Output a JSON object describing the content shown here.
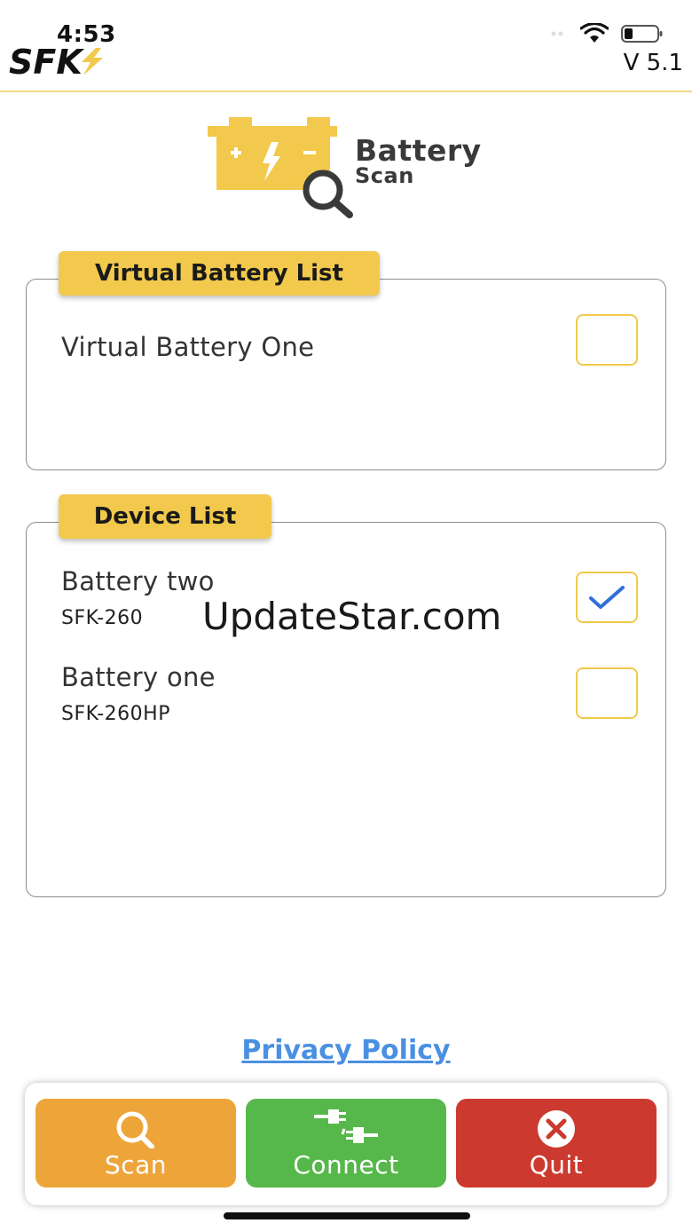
{
  "status_bar": {
    "time": "4:53",
    "brand": "SFK",
    "version": "V 5.1"
  },
  "hero": {
    "title": "Battery",
    "subtitle": "Scan"
  },
  "virtual_list": {
    "title": "Virtual Battery List",
    "items": [
      {
        "name": "Virtual Battery One",
        "checked": false
      }
    ]
  },
  "device_list": {
    "title": "Device List",
    "items": [
      {
        "name": "Battery two",
        "model": "SFK-260",
        "checked": true
      },
      {
        "name": "Battery one",
        "model": "SFK-260HP",
        "checked": false
      }
    ]
  },
  "watermark": "UpdateStar.com",
  "privacy_link": "Privacy Policy",
  "toolbar": {
    "scan_label": "Scan",
    "connect_label": "Connect",
    "quit_label": "Quit"
  },
  "colors": {
    "accent_yellow": "#f2c94c",
    "scan_orange": "#eda53a",
    "connect_green": "#56b84a",
    "quit_red": "#cc3a2f",
    "link_blue": "#4a90e2",
    "check_blue": "#2f6fdb"
  }
}
